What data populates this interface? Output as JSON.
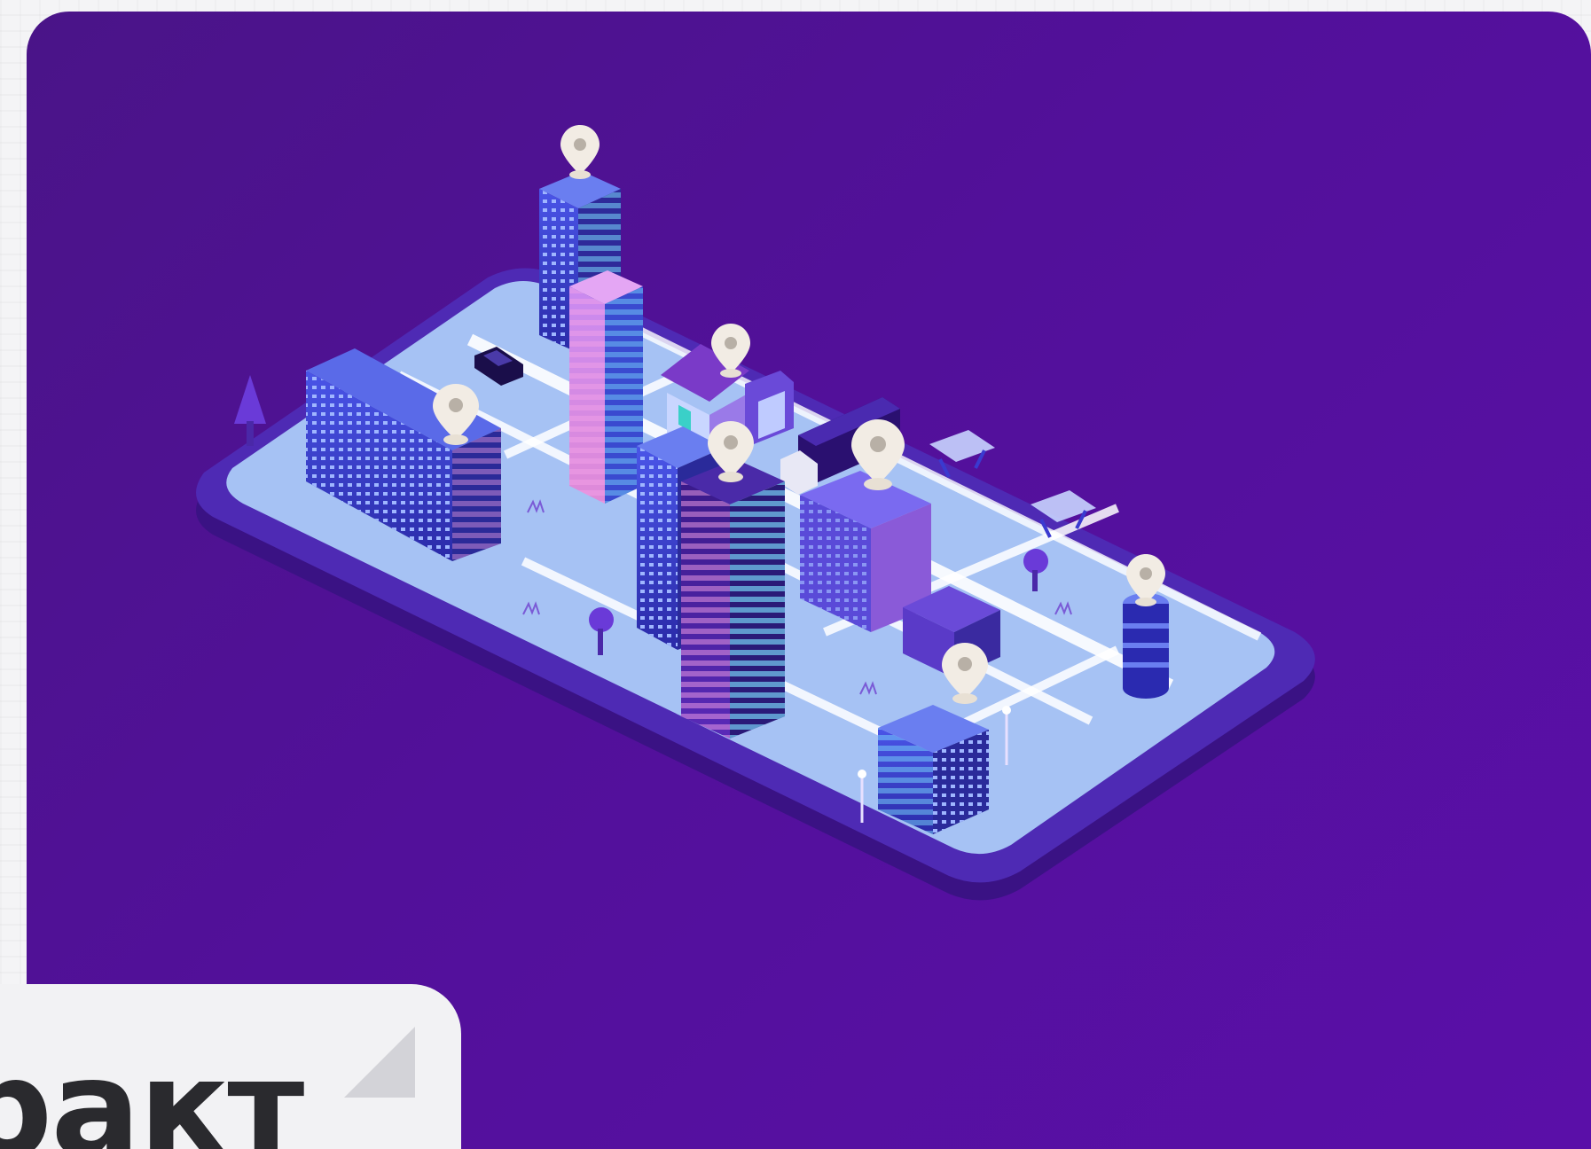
{
  "caption": {
    "text": "ракт"
  },
  "illustration": {
    "subject": "isometric-city-on-smartphone",
    "pin_icon": "map-pin-icon",
    "colors": {
      "background": "#52109a",
      "phone_body": "#3d1488",
      "screen": "#a9c4f5",
      "road": "#ffffff",
      "building_blue": "#3a3fd4",
      "building_pink": "#d986e8",
      "pin": "#f2ece4"
    }
  }
}
